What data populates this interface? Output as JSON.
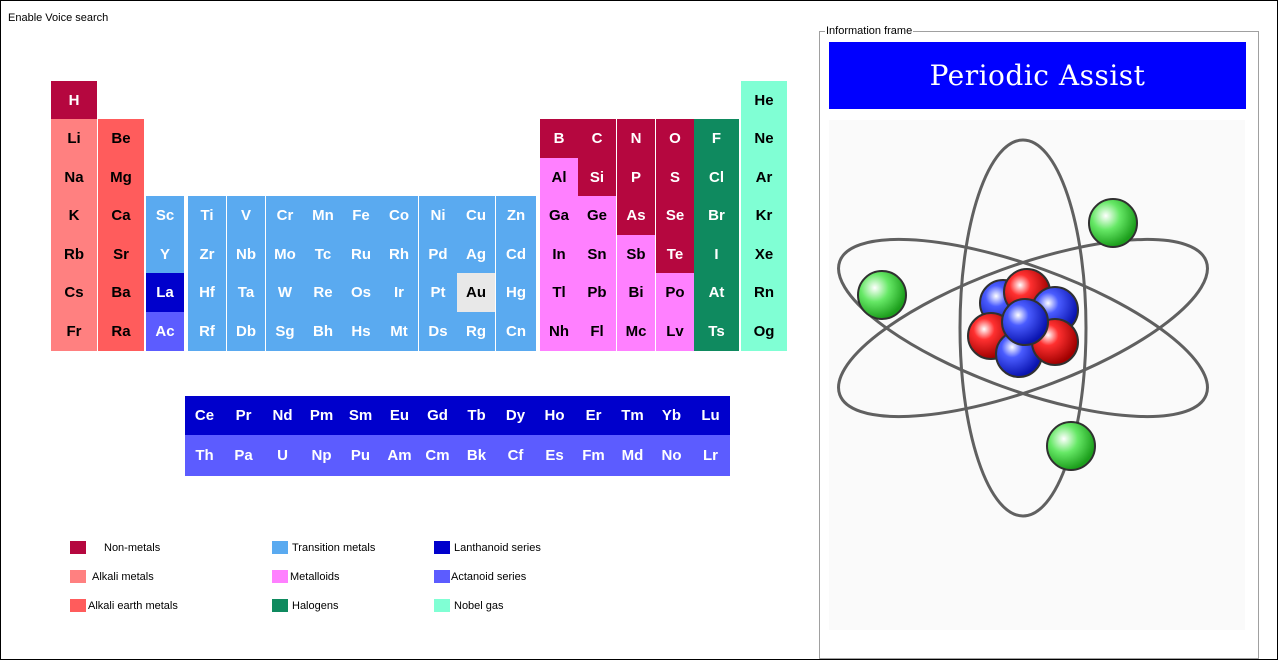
{
  "app": {
    "voice_search_label": "Enable Voice search",
    "info_frame_label": "Information frame",
    "title": "Periodic Assist"
  },
  "colors": {
    "nonmetal": "#b5073f",
    "alkali": "#ff8080",
    "alkaline_earth": "#ff5c5c",
    "transition": "#5aaaf0",
    "metalloid": "#ff80ff",
    "halogen": "#0f8a5f",
    "noble": "#80ffd4",
    "lanthanoid": "#0000cc",
    "actinoid": "#5c5cff",
    "selected": "#e8e8e8"
  },
  "elements": [
    {
      "sym": "H",
      "row": 1,
      "col": 1,
      "cat": "nonmetal"
    },
    {
      "sym": "He",
      "row": 1,
      "col": 18,
      "cat": "noble"
    },
    {
      "sym": "Li",
      "row": 2,
      "col": 1,
      "cat": "alkali"
    },
    {
      "sym": "Be",
      "row": 2,
      "col": 2,
      "cat": "alkaline_earth"
    },
    {
      "sym": "B",
      "row": 2,
      "col": 13,
      "cat": "nonmetal"
    },
    {
      "sym": "C",
      "row": 2,
      "col": 14,
      "cat": "nonmetal"
    },
    {
      "sym": "N",
      "row": 2,
      "col": 15,
      "cat": "nonmetal"
    },
    {
      "sym": "O",
      "row": 2,
      "col": 16,
      "cat": "nonmetal"
    },
    {
      "sym": "F",
      "row": 2,
      "col": 17,
      "cat": "halogen"
    },
    {
      "sym": "Ne",
      "row": 2,
      "col": 18,
      "cat": "noble"
    },
    {
      "sym": "Na",
      "row": 3,
      "col": 1,
      "cat": "alkali"
    },
    {
      "sym": "Mg",
      "row": 3,
      "col": 2,
      "cat": "alkaline_earth"
    },
    {
      "sym": "Al",
      "row": 3,
      "col": 13,
      "cat": "metalloid"
    },
    {
      "sym": "Si",
      "row": 3,
      "col": 14,
      "cat": "nonmetal"
    },
    {
      "sym": "P",
      "row": 3,
      "col": 15,
      "cat": "nonmetal"
    },
    {
      "sym": "S",
      "row": 3,
      "col": 16,
      "cat": "nonmetal"
    },
    {
      "sym": "Cl",
      "row": 3,
      "col": 17,
      "cat": "halogen"
    },
    {
      "sym": "Ar",
      "row": 3,
      "col": 18,
      "cat": "noble"
    },
    {
      "sym": "K",
      "row": 4,
      "col": 1,
      "cat": "alkali"
    },
    {
      "sym": "Ca",
      "row": 4,
      "col": 2,
      "cat": "alkaline_earth"
    },
    {
      "sym": "Sc",
      "row": 4,
      "col": 3,
      "cat": "transition"
    },
    {
      "sym": "Ti",
      "row": 4,
      "col": 4,
      "cat": "transition"
    },
    {
      "sym": "V",
      "row": 4,
      "col": 5,
      "cat": "transition"
    },
    {
      "sym": "Cr",
      "row": 4,
      "col": 6,
      "cat": "transition"
    },
    {
      "sym": "Mn",
      "row": 4,
      "col": 7,
      "cat": "transition"
    },
    {
      "sym": "Fe",
      "row": 4,
      "col": 8,
      "cat": "transition"
    },
    {
      "sym": "Co",
      "row": 4,
      "col": 9,
      "cat": "transition"
    },
    {
      "sym": "Ni",
      "row": 4,
      "col": 10,
      "cat": "transition"
    },
    {
      "sym": "Cu",
      "row": 4,
      "col": 11,
      "cat": "transition"
    },
    {
      "sym": "Zn",
      "row": 4,
      "col": 12,
      "cat": "transition"
    },
    {
      "sym": "Ga",
      "row": 4,
      "col": 13,
      "cat": "metalloid"
    },
    {
      "sym": "Ge",
      "row": 4,
      "col": 14,
      "cat": "metalloid"
    },
    {
      "sym": "As",
      "row": 4,
      "col": 15,
      "cat": "nonmetal"
    },
    {
      "sym": "Se",
      "row": 4,
      "col": 16,
      "cat": "nonmetal"
    },
    {
      "sym": "Br",
      "row": 4,
      "col": 17,
      "cat": "halogen"
    },
    {
      "sym": "Kr",
      "row": 4,
      "col": 18,
      "cat": "noble"
    },
    {
      "sym": "Rb",
      "row": 5,
      "col": 1,
      "cat": "alkali"
    },
    {
      "sym": "Sr",
      "row": 5,
      "col": 2,
      "cat": "alkaline_earth"
    },
    {
      "sym": "Y",
      "row": 5,
      "col": 3,
      "cat": "transition"
    },
    {
      "sym": "Zr",
      "row": 5,
      "col": 4,
      "cat": "transition"
    },
    {
      "sym": "Nb",
      "row": 5,
      "col": 5,
      "cat": "transition"
    },
    {
      "sym": "Mo",
      "row": 5,
      "col": 6,
      "cat": "transition"
    },
    {
      "sym": "Tc",
      "row": 5,
      "col": 7,
      "cat": "transition"
    },
    {
      "sym": "Ru",
      "row": 5,
      "col": 8,
      "cat": "transition"
    },
    {
      "sym": "Rh",
      "row": 5,
      "col": 9,
      "cat": "transition"
    },
    {
      "sym": "Pd",
      "row": 5,
      "col": 10,
      "cat": "transition"
    },
    {
      "sym": "Ag",
      "row": 5,
      "col": 11,
      "cat": "transition"
    },
    {
      "sym": "Cd",
      "row": 5,
      "col": 12,
      "cat": "transition"
    },
    {
      "sym": "In",
      "row": 5,
      "col": 13,
      "cat": "metalloid"
    },
    {
      "sym": "Sn",
      "row": 5,
      "col": 14,
      "cat": "metalloid"
    },
    {
      "sym": "Sb",
      "row": 5,
      "col": 15,
      "cat": "metalloid"
    },
    {
      "sym": "Te",
      "row": 5,
      "col": 16,
      "cat": "nonmetal"
    },
    {
      "sym": "I",
      "row": 5,
      "col": 17,
      "cat": "halogen"
    },
    {
      "sym": "Xe",
      "row": 5,
      "col": 18,
      "cat": "noble"
    },
    {
      "sym": "Cs",
      "row": 6,
      "col": 1,
      "cat": "alkali"
    },
    {
      "sym": "Ba",
      "row": 6,
      "col": 2,
      "cat": "alkaline_earth"
    },
    {
      "sym": "La",
      "row": 6,
      "col": 3,
      "cat": "lanthanoid"
    },
    {
      "sym": "Hf",
      "row": 6,
      "col": 4,
      "cat": "transition"
    },
    {
      "sym": "Ta",
      "row": 6,
      "col": 5,
      "cat": "transition"
    },
    {
      "sym": "W",
      "row": 6,
      "col": 6,
      "cat": "transition"
    },
    {
      "sym": "Re",
      "row": 6,
      "col": 7,
      "cat": "transition"
    },
    {
      "sym": "Os",
      "row": 6,
      "col": 8,
      "cat": "transition"
    },
    {
      "sym": "Ir",
      "row": 6,
      "col": 9,
      "cat": "transition"
    },
    {
      "sym": "Pt",
      "row": 6,
      "col": 10,
      "cat": "transition"
    },
    {
      "sym": "Au",
      "row": 6,
      "col": 11,
      "cat": "selected"
    },
    {
      "sym": "Hg",
      "row": 6,
      "col": 12,
      "cat": "transition"
    },
    {
      "sym": "Tl",
      "row": 6,
      "col": 13,
      "cat": "metalloid"
    },
    {
      "sym": "Pb",
      "row": 6,
      "col": 14,
      "cat": "metalloid"
    },
    {
      "sym": "Bi",
      "row": 6,
      "col": 15,
      "cat": "metalloid"
    },
    {
      "sym": "Po",
      "row": 6,
      "col": 16,
      "cat": "metalloid"
    },
    {
      "sym": "At",
      "row": 6,
      "col": 17,
      "cat": "halogen"
    },
    {
      "sym": "Rn",
      "row": 6,
      "col": 18,
      "cat": "noble"
    },
    {
      "sym": "Fr",
      "row": 7,
      "col": 1,
      "cat": "alkali"
    },
    {
      "sym": "Ra",
      "row": 7,
      "col": 2,
      "cat": "alkaline_earth"
    },
    {
      "sym": "Ac",
      "row": 7,
      "col": 3,
      "cat": "actinoid"
    },
    {
      "sym": "Rf",
      "row": 7,
      "col": 4,
      "cat": "transition"
    },
    {
      "sym": "Db",
      "row": 7,
      "col": 5,
      "cat": "transition"
    },
    {
      "sym": "Sg",
      "row": 7,
      "col": 6,
      "cat": "transition"
    },
    {
      "sym": "Bh",
      "row": 7,
      "col": 7,
      "cat": "transition"
    },
    {
      "sym": "Hs",
      "row": 7,
      "col": 8,
      "cat": "transition"
    },
    {
      "sym": "Mt",
      "row": 7,
      "col": 9,
      "cat": "transition"
    },
    {
      "sym": "Ds",
      "row": 7,
      "col": 10,
      "cat": "transition"
    },
    {
      "sym": "Rg",
      "row": 7,
      "col": 11,
      "cat": "transition"
    },
    {
      "sym": "Cn",
      "row": 7,
      "col": 12,
      "cat": "transition"
    },
    {
      "sym": "Nh",
      "row": 7,
      "col": 13,
      "cat": "metalloid"
    },
    {
      "sym": "Fl",
      "row": 7,
      "col": 14,
      "cat": "metalloid"
    },
    {
      "sym": "Mc",
      "row": 7,
      "col": 15,
      "cat": "metalloid"
    },
    {
      "sym": "Lv",
      "row": 7,
      "col": 16,
      "cat": "metalloid"
    },
    {
      "sym": "Ts",
      "row": 7,
      "col": 17,
      "cat": "halogen"
    },
    {
      "sym": "Og",
      "row": 7,
      "col": 18,
      "cat": "noble"
    }
  ],
  "lanthanoids": [
    "Ce",
    "Pr",
    "Nd",
    "Pm",
    "Sm",
    "Eu",
    "Gd",
    "Tb",
    "Dy",
    "Ho",
    "Er",
    "Tm",
    "Yb",
    "Lu"
  ],
  "actinoids": [
    "Th",
    "Pa",
    "U",
    "Np",
    "Pu",
    "Am",
    "Cm",
    "Bk",
    "Cf",
    "Es",
    "Fm",
    "Md",
    "No",
    "Lr"
  ],
  "legend": [
    {
      "label": " Non-metals",
      "cat": "nonmetal"
    },
    {
      "label": "Alkali metals",
      "cat": "alkali"
    },
    {
      "label": "Alkali earth metals",
      "cat": "alkaline_earth"
    },
    {
      "label": "Transition metals",
      "cat": "transition"
    },
    {
      "label": "Metalloids",
      "cat": "metalloid"
    },
    {
      "label": "Halogens",
      "cat": "halogen"
    },
    {
      "label": "Lanthanoid series",
      "cat": "lanthanoid"
    },
    {
      "label": "Actanoid series",
      "cat": "actinoid"
    },
    {
      "label": "Nobel gas",
      "cat": "noble"
    }
  ]
}
